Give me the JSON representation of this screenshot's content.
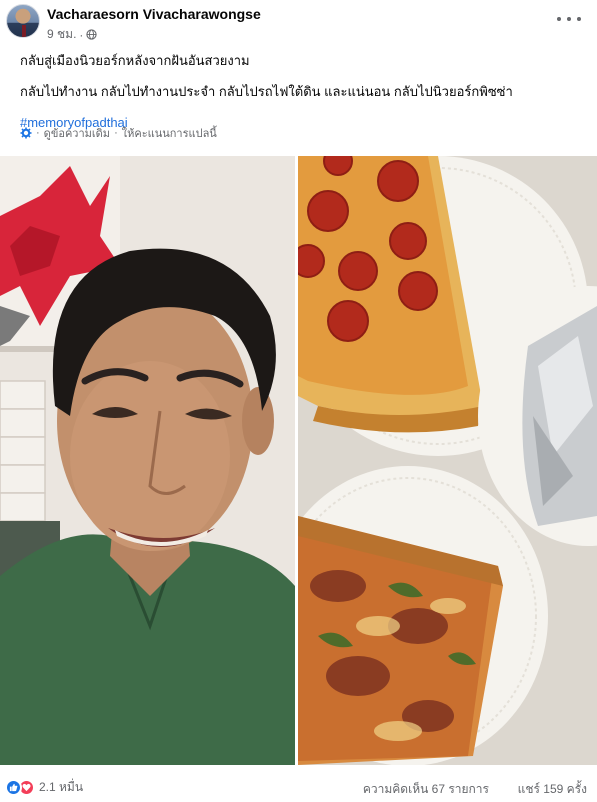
{
  "post": {
    "author": "Vacharaesorn Vivacharawongse",
    "time": "9 ชม.",
    "separator": "·",
    "privacy_icon": "globe-icon",
    "more_icon": "ellipsis-icon",
    "lines": [
      "กลับสู่เมืองนิวยอร์กหลังจากฝันอันสวยงาม",
      "กลับไปทำงาน กลับไปทำงานประจำ กลับไปรถไฟใต้ดิน และแน่นอน กลับไปนิวยอร์กพิซซ่า"
    ],
    "hashtag": "#memoryofpadthai",
    "see_original": "ดูข้อความเดิม",
    "translate_dot": "·",
    "rate_translation": "ให้คะแนนการแปลนี้"
  },
  "photos": [
    {
      "icon": "selfie-photo",
      "subject": "selfie-man-green-shirt"
    },
    {
      "icon": "pizza-photo",
      "subject": "pizza-slices-on-paper-plates"
    }
  ],
  "footer": {
    "reaction_icons": [
      "like-icon",
      "love-icon"
    ],
    "reaction_count": "2.1 หมื่น",
    "comments": "ความคิดเห็น 67 รายการ",
    "shares": "แชร์ 159 ครั้ง"
  },
  "colors": {
    "link": "#216fdb",
    "secondary_text": "#65676b",
    "like": "#1b74e4",
    "love": "#f33e58"
  }
}
